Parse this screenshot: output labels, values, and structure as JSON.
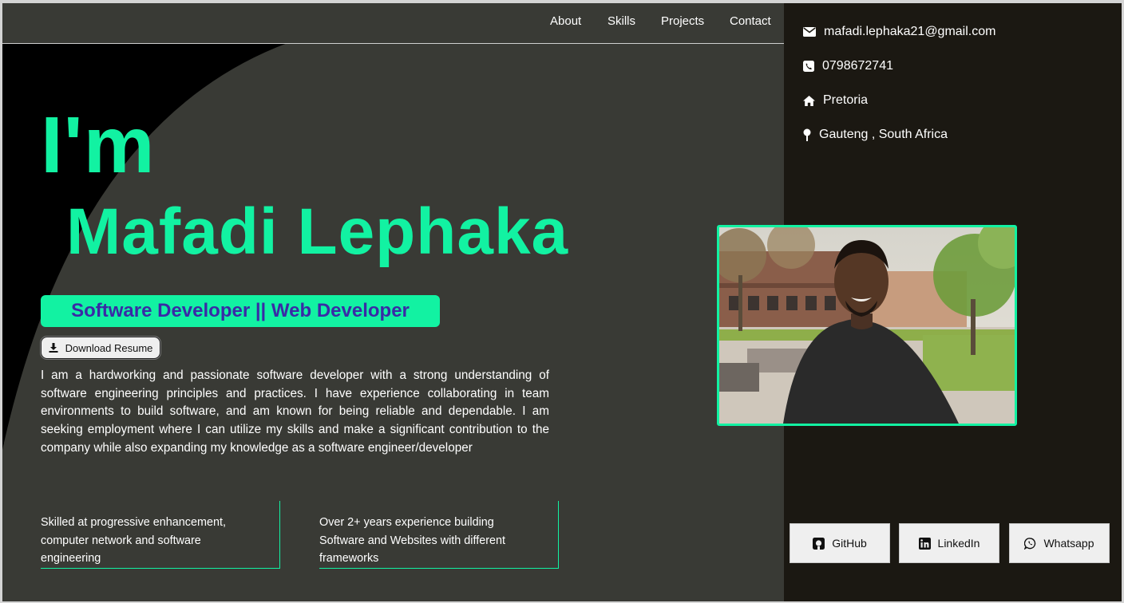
{
  "nav": {
    "about": "About",
    "skills": "Skills",
    "projects": "Projects",
    "contact": "Contact"
  },
  "hero": {
    "greeting": "I'm",
    "name": "Mafadi Lephaka",
    "role": "Software Developer || Web Developer",
    "download_label": "Download Resume",
    "bio": "I am a hardworking and passionate software developer with a strong understanding of software engineering principles and practices. I have experience collaborating in team environments to build software, and am known for being reliable and dependable. I am seeking employment where I can utilize my skills and make a significant contribution to the company while also expanding my knowledge as a software engineer/developer"
  },
  "highlights": [
    "Skilled at progressive enhancement, computer network and software engineering",
    "Over 2+ years experience building Software and Websites with different frameworks"
  ],
  "contact": {
    "email": "mafadi.lephaka21@gmail.com",
    "phone": "0798672741",
    "city": "Pretoria",
    "region": "Gauteng , South Africa"
  },
  "social": {
    "github": "GitHub",
    "linkedin": "LinkedIn",
    "whatsapp": "Whatsapp"
  },
  "icons": [
    "envelope-icon",
    "phone-icon",
    "home-icon",
    "map-pin-icon",
    "download-icon",
    "github-icon",
    "linkedin-icon",
    "whatsapp-icon"
  ],
  "colors": {
    "accent": "#12f2a2",
    "left_bg": "#393a35",
    "right_bg": "#1b1812",
    "role_text": "#3a2aa6"
  }
}
